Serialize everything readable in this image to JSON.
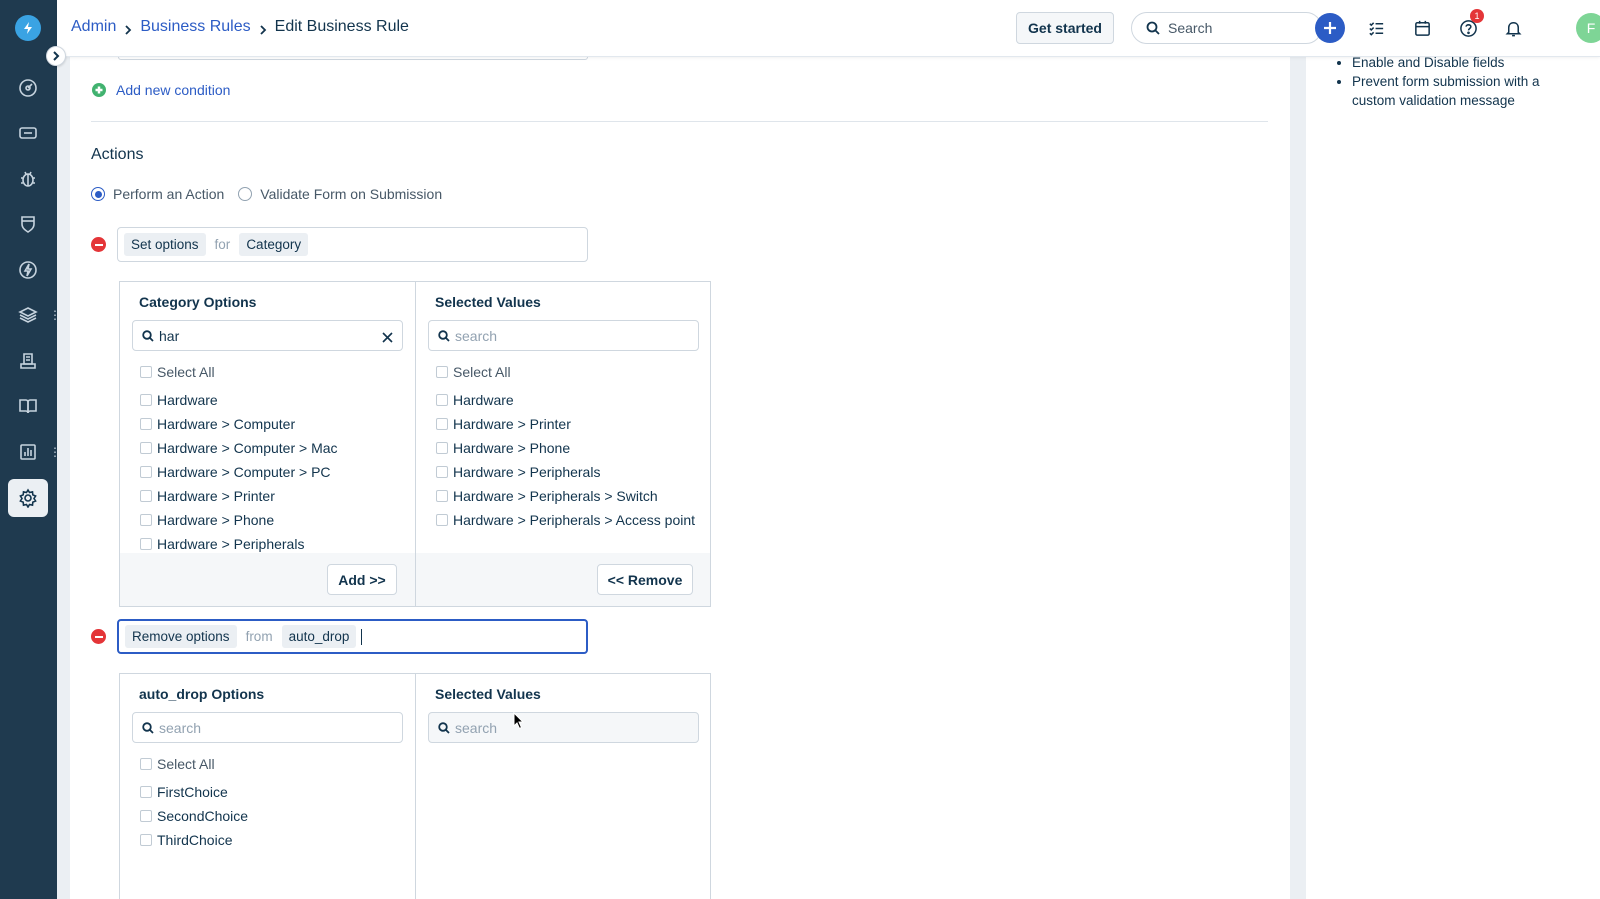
{
  "header": {
    "breadcrumb": [
      "Admin",
      "Business Rules",
      "Edit Business Rule"
    ],
    "get_started": "Get started",
    "search_placeholder": "Search",
    "notification_count": "1",
    "avatar_initial": "F"
  },
  "nav": {
    "items": [
      "dashboard",
      "tickets",
      "problems",
      "changes",
      "releases",
      "assets",
      "solutions",
      "analytics-book",
      "reports",
      "admin"
    ],
    "active": "admin"
  },
  "side_panel": {
    "bullets": [
      "Enable and Disable fields",
      "Prevent form submission with a custom validation message"
    ]
  },
  "conditions": {
    "add_label": "Add new condition"
  },
  "actions": {
    "title": "Actions",
    "radio_options": [
      "Perform an Action",
      "Validate Form on Submission"
    ],
    "selected_radio": "Perform an Action",
    "action1": {
      "verb": "Set options",
      "joiner": "for",
      "field": "Category",
      "left_title": "Category Options",
      "left_search": "har",
      "left_options": [
        "Select All",
        "Hardware",
        "Hardware > Computer",
        "Hardware > Computer > Mac",
        "Hardware > Computer > PC",
        "Hardware > Printer",
        "Hardware > Phone",
        "Hardware > Peripherals"
      ],
      "right_title": "Selected Values",
      "right_search_placeholder": "search",
      "right_options": [
        "Select All",
        "Hardware",
        "Hardware > Printer",
        "Hardware > Phone",
        "Hardware > Peripherals",
        "Hardware > Peripherals > Switch",
        "Hardware > Peripherals > Access point"
      ],
      "add_button": "Add >>",
      "remove_button": "<< Remove"
    },
    "action2": {
      "verb": "Remove options",
      "joiner": "from",
      "field": "auto_drop",
      "left_title": "auto_drop Options",
      "left_search_placeholder": "search",
      "left_options": [
        "Select All",
        "FirstChoice",
        "SecondChoice",
        "ThirdChoice"
      ],
      "right_title": "Selected Values",
      "right_search_placeholder": "search"
    }
  },
  "colors": {
    "primary": "#2c5cc5",
    "nav_bg": "#1f3a4f",
    "danger": "#e43538",
    "success": "#41b26f"
  }
}
